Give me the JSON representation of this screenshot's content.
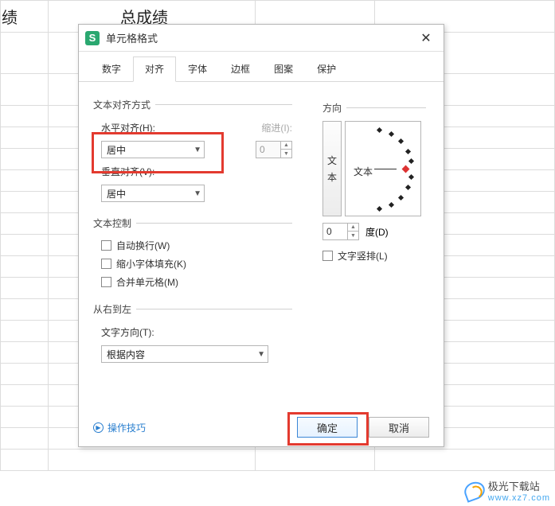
{
  "bg": {
    "header_cells": [
      "绩",
      "总成绩"
    ]
  },
  "dialog": {
    "title": "单元格格式",
    "tabs": [
      "数字",
      "对齐",
      "字体",
      "边框",
      "图案",
      "保护"
    ],
    "active_tab": 1,
    "alignment": {
      "legend": "文本对齐方式",
      "h_label": "水平对齐(H):",
      "h_value": "居中",
      "indent_label": "缩进(I):",
      "indent_value": "0",
      "v_label": "垂直对齐(V):",
      "v_value": "居中"
    },
    "text_control": {
      "legend": "文本控制",
      "wrap": "自动换行(W)",
      "shrink": "缩小字体填充(K)",
      "merge": "合并单元格(M)"
    },
    "rtl": {
      "legend": "从右到左",
      "dir_label": "文字方向(T):",
      "dir_value": "根据内容"
    },
    "orientation": {
      "legend": "方向",
      "vertical_btn": [
        "文",
        "本"
      ],
      "dial_text": "文本",
      "deg_value": "0",
      "deg_label": "度(D)",
      "vertical_text": "文字竖排(L)"
    },
    "help": "操作技巧",
    "ok": "确定",
    "cancel": "取消"
  },
  "watermark": {
    "text": "极光下载站",
    "url": "www.xz7.com"
  }
}
